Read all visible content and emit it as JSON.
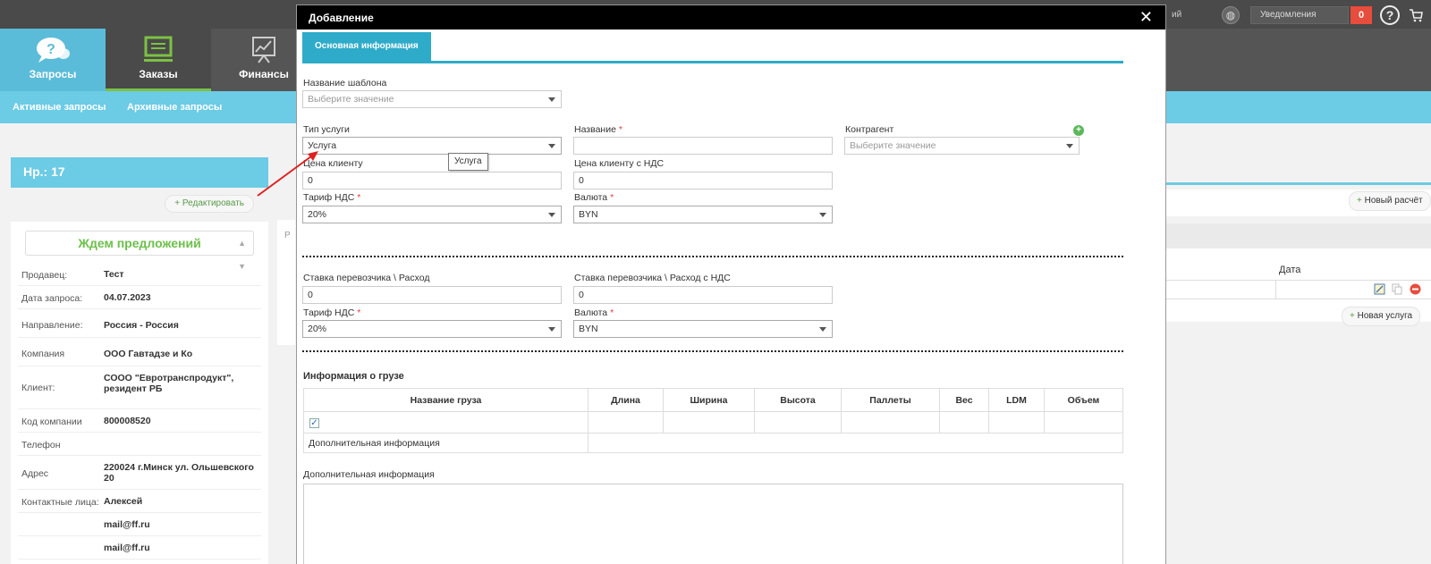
{
  "topbar": {
    "user_fragment": "ий",
    "notifications_label": "Уведомления",
    "notifications_count": "0",
    "icons": [
      "globe-icon",
      "help-icon",
      "cart-icon"
    ]
  },
  "nav": {
    "items": [
      {
        "label": "Запросы",
        "icon": "question-chat-icon"
      },
      {
        "label": "Заказы",
        "icon": "monitor-icon"
      },
      {
        "label": "Финансы",
        "icon": "presentation-icon"
      }
    ]
  },
  "subnav": {
    "active_requests": "Активные запросы",
    "archived_requests": "Архивные запросы"
  },
  "request": {
    "number": "Нр.: 17",
    "edit_button": "Редактировать",
    "status": "Ждем предложений",
    "rows": [
      {
        "key": "Продавец:",
        "value": "Тест"
      },
      {
        "key": "Дата запроса:",
        "value": "04.07.2023"
      },
      {
        "key": "Направление:",
        "value": "Россия - Россия"
      },
      {
        "key": "Компания",
        "value": "ООО Гавтадзе и Ко"
      },
      {
        "key": "Клиент:",
        "value": "СООО \"Евротранспродукт\", резидент РБ"
      },
      {
        "key": "Код компании",
        "value": "800008520"
      },
      {
        "key": "Телефон",
        "value": ""
      },
      {
        "key": "Адрес",
        "value": "220024 г.Минск ул. Ольшевского 20"
      },
      {
        "key": "Контактные лица:",
        "value": "Алексей"
      },
      {
        "key": "",
        "value": "mail@ff.ru"
      },
      {
        "key": "",
        "value": "mail@ff.ru"
      }
    ]
  },
  "right_panel": {
    "new_calc_button": "Новый расчёт",
    "date_header": "Дата",
    "new_service_button": "Новая услуга",
    "fragment_letter": "Р"
  },
  "modal": {
    "title": "Добавление",
    "tab": "Основная информация",
    "template_name": {
      "label": "Название шаблона",
      "placeholder": "Выберите значение"
    },
    "service_type": {
      "label": "Тип услуги",
      "value": "Услуга",
      "tooltip": "Услуга"
    },
    "name": {
      "label": "Название",
      "required": "*",
      "value": ""
    },
    "counterparty": {
      "label": "Контрагент",
      "placeholder": "Выберите значение"
    },
    "client_price": {
      "label": "Цена клиенту",
      "value": "0"
    },
    "client_price_vat": {
      "label": "Цена клиенту с НДС",
      "value": "0"
    },
    "vat_rate_1": {
      "label": "Тариф НДС",
      "required": "*",
      "value": "20%"
    },
    "currency_1": {
      "label": "Валюта",
      "required": "*",
      "value": "BYN"
    },
    "carrier_rate": {
      "label": "Ставка перевозчика \\ Расход",
      "value": "0"
    },
    "carrier_rate_vat": {
      "label": "Ставка перевозчика \\ Расход с НДС",
      "value": "0"
    },
    "vat_rate_2": {
      "label": "Тариф НДС",
      "required": "*",
      "value": "20%"
    },
    "currency_2": {
      "label": "Валюта",
      "required": "*",
      "value": "BYN"
    },
    "cargo": {
      "title": "Информация о грузе",
      "columns": [
        "Название груза",
        "Длина",
        "Ширина",
        "Высота",
        "Паллеты",
        "Вес",
        "LDM",
        "Объем"
      ],
      "extra_info": "Дополнительная информация"
    },
    "additional_info": {
      "label": "Дополнительная информация",
      "value": ""
    }
  },
  "colors": {
    "accent": "#2eabc9",
    "light_accent": "#6ccbe5",
    "status_green": "#6cc04a",
    "danger": "#e74c3c"
  }
}
